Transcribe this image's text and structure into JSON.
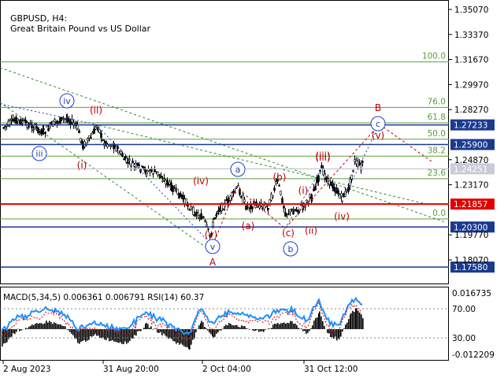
{
  "header": {
    "symbol": "GBPUSD, H4:",
    "description": "Great Britain Pound vs US Dollar"
  },
  "colors": {
    "background": "#ffffff",
    "candles": "#000000",
    "wave_red": "#c00000",
    "wave_blue": "#1a3fc2",
    "fib_green": "#5c9e3a",
    "trend_green": "#2f8a2f",
    "level_blue": "#1a3a8f",
    "level_red": "#e00000",
    "macd_hist": "#000000",
    "rsi_line": "#1e90ff",
    "signal_line": "#d00000",
    "badge_blue": "#1a3a8f",
    "badge_red": "#e00000",
    "badge_gray": "#c8ccd4"
  },
  "price_axis": {
    "ticks": [
      "1.35070",
      "1.33370",
      "1.31670",
      "1.29970",
      "1.28270",
      "1.24870",
      "1.23170",
      "1.19770",
      "1.18070"
    ],
    "current_price": "1.24251",
    "levels": [
      {
        "price": "1.27233",
        "type": "blue"
      },
      {
        "price": "1.25900",
        "type": "blue"
      },
      {
        "price": "1.21857",
        "type": "red"
      },
      {
        "price": "1.20300",
        "type": "blue"
      },
      {
        "price": "1.17580",
        "type": "blue"
      }
    ]
  },
  "fib_levels": [
    {
      "label": "100.0",
      "price": 1.3151
    },
    {
      "label": "76.0",
      "price": 1.2842
    },
    {
      "label": "61.8",
      "price": 1.2737
    },
    {
      "label": "50.0",
      "price": 1.2626
    },
    {
      "label": "38.2",
      "price": 1.2511
    },
    {
      "label": "23.6",
      "price": 1.2358
    },
    {
      "label": "0.0",
      "price": 1.2085
    }
  ],
  "wave_labels": [
    {
      "text": "iv",
      "style": "circle-blue"
    },
    {
      "text": "iii",
      "style": "circle-blue"
    },
    {
      "text": "(ii)",
      "style": "red"
    },
    {
      "text": "(i)",
      "style": "red"
    },
    {
      "text": "(iv)",
      "style": "red"
    },
    {
      "text": "(iii)",
      "style": "red"
    },
    {
      "text": "(v)",
      "style": "red"
    },
    {
      "text": "v",
      "style": "circle-blue"
    },
    {
      "text": "A",
      "style": "red-plain"
    },
    {
      "text": "a",
      "style": "circle-blue"
    },
    {
      "text": "(a)",
      "style": "red"
    },
    {
      "text": "(b)",
      "style": "red"
    },
    {
      "text": "(c)",
      "style": "red"
    },
    {
      "text": "b",
      "style": "circle-blue"
    },
    {
      "text": "(i)",
      "style": "red"
    },
    {
      "text": "(ii)",
      "style": "red"
    },
    {
      "text": "(iii)",
      "style": "red"
    },
    {
      "text": "(iv)",
      "style": "red"
    },
    {
      "text": "(v)",
      "style": "red"
    },
    {
      "text": "c",
      "style": "circle-blue"
    },
    {
      "text": "B",
      "style": "red-plain"
    }
  ],
  "macd_panel": {
    "label": "MACD(5,34,5) 0.006361 0.006791 RSI(14) 60.37",
    "ticks": [
      "0.016735",
      "70.00",
      "30.00",
      "-0.012209"
    ]
  },
  "time_axis": {
    "labels": [
      "2 Aug 2023",
      "31 Aug 20:00",
      "2 Oct 04:00",
      "31 Oct 12:00"
    ]
  }
}
